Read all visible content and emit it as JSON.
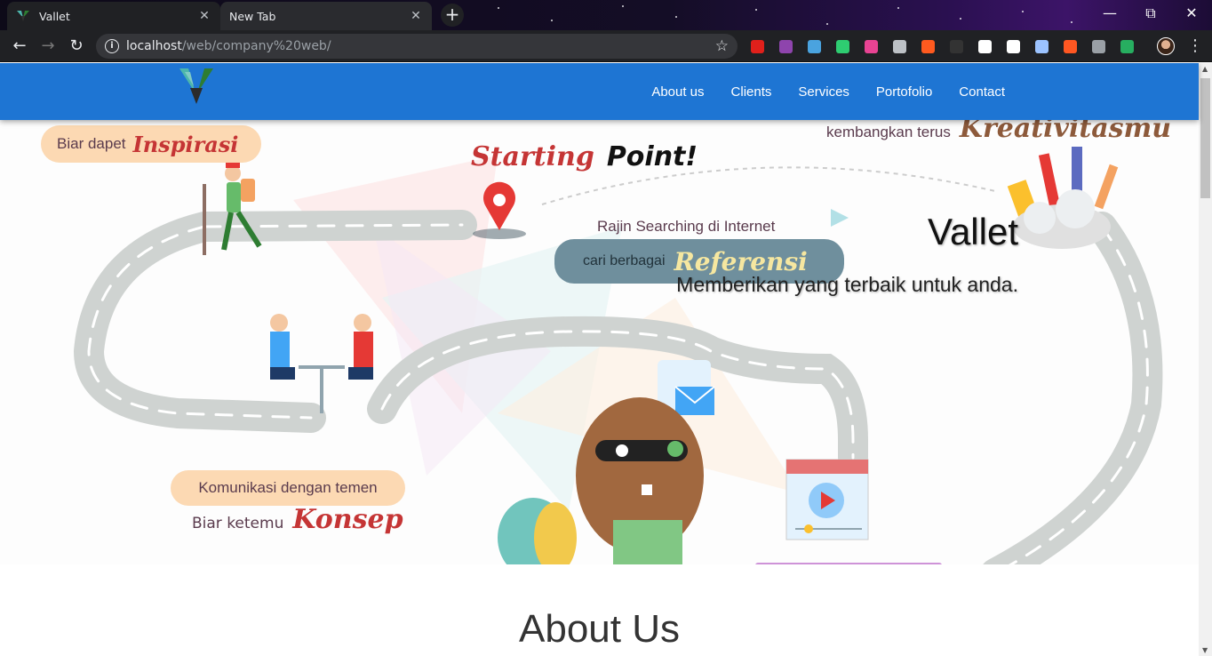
{
  "browser": {
    "tabs": [
      {
        "title": "Vallet",
        "active": true
      },
      {
        "title": "New Tab",
        "active": false
      }
    ],
    "new_tab_icon": "plus-icon",
    "url_host": "localhost",
    "url_path": "/web/company%20web/",
    "window_controls": [
      "minimize-icon",
      "restore-icon",
      "close-icon"
    ],
    "extensions": [
      {
        "name": "adblock-icon",
        "color": "#e0201b"
      },
      {
        "name": "crossed-box-icon",
        "color": "#8e44ad"
      },
      {
        "name": "diamond-icon",
        "color": "#4aa3df"
      },
      {
        "name": "stack-icon",
        "color": "#2ecc71"
      },
      {
        "name": "color-ring-icon",
        "color": "#e84393"
      },
      {
        "name": "pocket-icon",
        "color": "#bdc1c6"
      },
      {
        "name": "infinity-icon",
        "color": "#ff5a1f"
      },
      {
        "name": "question-icon",
        "color": "#333333"
      },
      {
        "name": "w-icon",
        "color": "#ffffff"
      },
      {
        "name": "speech-bubble-icon",
        "color": "#ffffff"
      },
      {
        "name": "bookmark-icon",
        "color": "#9cc3ff"
      },
      {
        "name": "ya-icon",
        "color": "#ff5722"
      },
      {
        "name": "rocket-icon",
        "color": "#9aa0a6"
      },
      {
        "name": "globe-icon",
        "color": "#27ae60"
      }
    ]
  },
  "site": {
    "brand_color": "#1e75d3",
    "nav": [
      "About us",
      "Clients",
      "Services",
      "Portofolio",
      "Contact"
    ],
    "hero": {
      "title": "Vallet",
      "subtitle": "Memberikan yang terbaik untuk anda.",
      "artwork": {
        "bubble1_prefix": "Biar dapet",
        "bubble1_script": "Inspirasi",
        "starting": "Starting",
        "point": "Point!",
        "search_line": "Rajin Searching di Internet",
        "ref_prefix": "cari berbagai",
        "ref_script": "Referensi",
        "top_right_prefix": "kembangkan terus",
        "top_right_script": "Kreativitasmu",
        "komunikasi": "Komunikasi dengan temen",
        "konsep_prefix": "Biar ketemu",
        "konsep_script": "Konsep"
      }
    },
    "about_heading": "About Us"
  }
}
